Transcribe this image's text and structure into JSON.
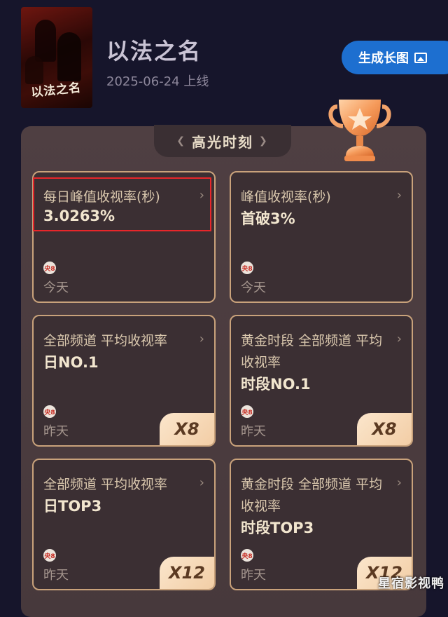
{
  "show": {
    "title": "以法之名",
    "release_date": "2025-06-24 上线",
    "poster_text": "以法之名"
  },
  "header": {
    "generate_button": "生成长图"
  },
  "highlights": {
    "title": "高光时刻",
    "cards": [
      {
        "title": "每日峰值收视率(秒)",
        "value": "3.0263%",
        "channel": "央8",
        "date": "今天",
        "multiplier": ""
      },
      {
        "title": "峰值收视率(秒)",
        "value": "首破3%",
        "channel": "央8",
        "date": "今天",
        "multiplier": ""
      },
      {
        "title": "全部频道 平均收视率",
        "value": "日NO.1",
        "channel": "央8",
        "date": "昨天",
        "multiplier": "X8"
      },
      {
        "title": "黄金时段 全部频道 平均收视率",
        "value": "时段NO.1",
        "channel": "央8",
        "date": "昨天",
        "multiplier": "X8"
      },
      {
        "title": "全部频道 平均收视率",
        "value": "日TOP3",
        "channel": "央8",
        "date": "昨天",
        "multiplier": "X12"
      },
      {
        "title": "黄金时段 全部频道 平均收视率",
        "value": "时段TOP3",
        "channel": "央8",
        "date": "昨天",
        "multiplier": "X12"
      }
    ]
  },
  "watermark": "星宿影视鸭",
  "colors": {
    "background": "#16152b",
    "button": "#1d6fd0",
    "card_border": "#c9a27b",
    "highlight_box": "#e8262a"
  }
}
